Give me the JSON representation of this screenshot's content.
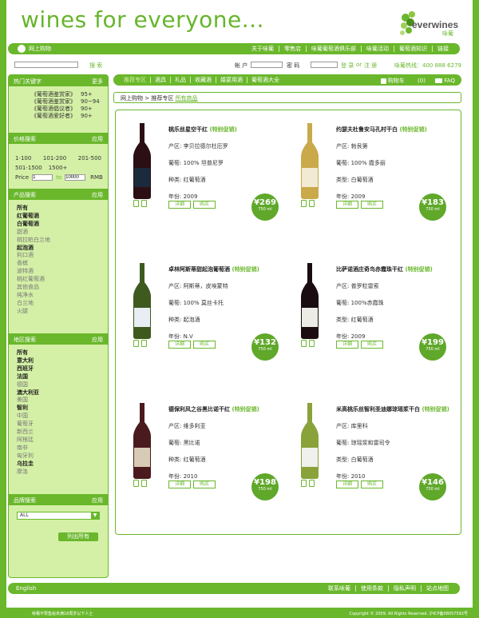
{
  "header": {
    "site_title": "wines for everyone...",
    "logo_text": "everwines",
    "logo_sub": "咏葡"
  },
  "topnav": {
    "left": "网上购物",
    "items": [
      "关于咏葡",
      "零售店",
      "咏葡葡萄酒俱乐部",
      "咏葡活动",
      "葡萄酒知识",
      "链接"
    ]
  },
  "searchrow": {
    "search_label": "搜 索",
    "account_label": "帐 户",
    "password_label": "密 码",
    "login": "登 录",
    "or": "or",
    "register": "注 册",
    "hotline": "咏葡热线：400 888 6279"
  },
  "sidebar": {
    "hot": {
      "title": "热门关键字",
      "more": "更多",
      "items": [
        {
          "k": "《葡萄酒鉴赏家》",
          "v": "95+"
        },
        {
          "k": "《葡萄酒鉴赏家》",
          "v": "90~94"
        },
        {
          "k": "《葡萄酒倡议者》",
          "v": "90+"
        },
        {
          "k": "《葡萄酒爱好者》",
          "v": "90+"
        }
      ]
    },
    "price": {
      "title": "价格搜索",
      "apply": "应用",
      "row1": [
        "1-100",
        "101-200",
        "201-500"
      ],
      "row2": [
        "501-1500",
        "1500+"
      ],
      "price_label": "Price",
      "from": "1",
      "to_label": "to",
      "to": "10000",
      "unit": "RMB"
    },
    "product": {
      "title": "产品搜索",
      "apply": "应用",
      "items": [
        {
          "t": "所有",
          "b": true
        },
        {
          "t": "红葡萄酒",
          "b": true
        },
        {
          "t": "白葡萄酒",
          "b": true
        },
        {
          "t": "甜酒",
          "b": false
        },
        {
          "t": "桃拉帕白兰地",
          "b": false
        },
        {
          "t": "起泡酒",
          "b": true
        },
        {
          "t": "利口酒",
          "b": false
        },
        {
          "t": "香槟",
          "b": false
        },
        {
          "t": "波特酒",
          "b": false
        },
        {
          "t": "桃红葡萄酒",
          "b": false
        },
        {
          "t": "其他食品",
          "b": false
        },
        {
          "t": "纯净水",
          "b": false
        },
        {
          "t": "白兰地",
          "b": false
        },
        {
          "t": "火腿",
          "b": false
        }
      ]
    },
    "region": {
      "title": "地区搜索",
      "apply": "应用",
      "items": [
        {
          "t": "所有",
          "b": true
        },
        {
          "t": "意大利",
          "b": true
        },
        {
          "t": "西班牙",
          "b": true
        },
        {
          "t": "法国",
          "b": true
        },
        {
          "t": "德国",
          "b": false
        },
        {
          "t": "澳大利亚",
          "b": true
        },
        {
          "t": "美国",
          "b": false
        },
        {
          "t": "智利",
          "b": true
        },
        {
          "t": "中国",
          "b": false
        },
        {
          "t": "葡萄牙",
          "b": false
        },
        {
          "t": "新西兰",
          "b": false
        },
        {
          "t": "阿根廷",
          "b": false
        },
        {
          "t": "南非",
          "b": false
        },
        {
          "t": "匈牙利",
          "b": false
        },
        {
          "t": "乌拉圭",
          "b": true
        },
        {
          "t": "摩洛",
          "b": false
        }
      ]
    },
    "brand": {
      "title": "品牌搜索",
      "apply": "应用",
      "select": "ALL",
      "list_all": "列出所有"
    }
  },
  "catnav": {
    "items": [
      "推荐专区",
      "酒具",
      "礼品",
      "收藏酒",
      "婚宴用酒",
      "葡萄酒大全"
    ],
    "cart": "购物车",
    "cart_count": "(0)",
    "faq": "FAQ"
  },
  "crumb": {
    "a": "网上购物",
    "b": "> 推荐专区",
    "c": "所有商品"
  },
  "products": [
    {
      "name": "桃乐丝星空干红",
      "promo": "(特别促销)",
      "l1": "产区: 李贝拉德尔杜厄罗",
      "l2": "葡萄: 100% 坦普尼罗",
      "l3": "种类: 红葡萄酒",
      "l4": "年份: 2009",
      "price": "¥269",
      "unit": "750 ml",
      "detail": "详细",
      "buy": "购买",
      "color": "#2b0f14",
      "label": "#1b2a3c"
    },
    {
      "name": "约瑟夫杜鲁安马孔村干白",
      "promo": "(特别促销)",
      "l1": "产区: 勃艮第",
      "l2": "葡萄: 100% 霞多丽",
      "l3": "类型: 白葡萄酒",
      "l4": "年份: 2009",
      "price": "¥183",
      "unit": "750 ml",
      "detail": "详细",
      "buy": "购买",
      "color": "#c9a94a",
      "label": "#f2ead2"
    },
    {
      "name": "卓林阿斯蒂甜起泡葡萄酒",
      "promo": "(特别促销)",
      "l1": "产区: 阿斯蒂，皮埃蒙特",
      "l2": "葡萄: 100% 莫丝卡托",
      "l3": "种类: 起泡酒",
      "l4": "年份: N.V",
      "price": "¥132",
      "unit": "750 ml",
      "detail": "详细",
      "buy": "购买",
      "color": "#3e5a1f",
      "label": "#e8eef4"
    },
    {
      "name": "比萨诺酒庄奇鸟赤霞珠干红",
      "promo": "(特别促销)",
      "l1": "产区: 普罗粒雷索",
      "l2": "葡萄: 100%赤霞珠",
      "l3": "类型: 红葡萄酒",
      "l4": "年份: 2009",
      "price": "¥199",
      "unit": "750 ml",
      "detail": "详细",
      "buy": "购买",
      "color": "#1a0c10",
      "label": "#ecebe6"
    },
    {
      "name": "德保利风之谷黑比诺干红",
      "promo": "(特别促销)",
      "l1": "产区: 维多利亚",
      "l2": "葡萄: 黑比诺",
      "l3": "种类: 红葡萄酒",
      "l4": "年份: 2010",
      "price": "¥198",
      "unit": "750 ml",
      "detail": "详细",
      "buy": "购买",
      "color": "#4a1a1e",
      "label": "#d8cbb5"
    },
    {
      "name": "米高桃乐丝智利圣迪娜琼瑶浆干白",
      "promo": "(特别促销)",
      "l1": "产区: 库里科",
      "l2": "葡萄: 琼瑶浆和雷司令",
      "l3": "类型: 白葡萄酒",
      "l4": "年份: 2010",
      "price": "¥146",
      "unit": "750 ml",
      "detail": "详细",
      "buy": "购买",
      "color": "#8aa23a",
      "label": "#f0f0ec"
    }
  ],
  "footer": {
    "lang": "English",
    "items": [
      "联系咏葡",
      "使用条款",
      "隐私声明",
      "站点地图"
    ]
  },
  "bottom": {
    "left": "咏葡不赞售给未满18周岁以下人士",
    "right": "Copyright © 2009. All Rights Reserved. 沪ICP备08057592号"
  },
  "colors": {
    "accent": "#6ab72c",
    "sidebar_bg": "#d4f0a6"
  }
}
